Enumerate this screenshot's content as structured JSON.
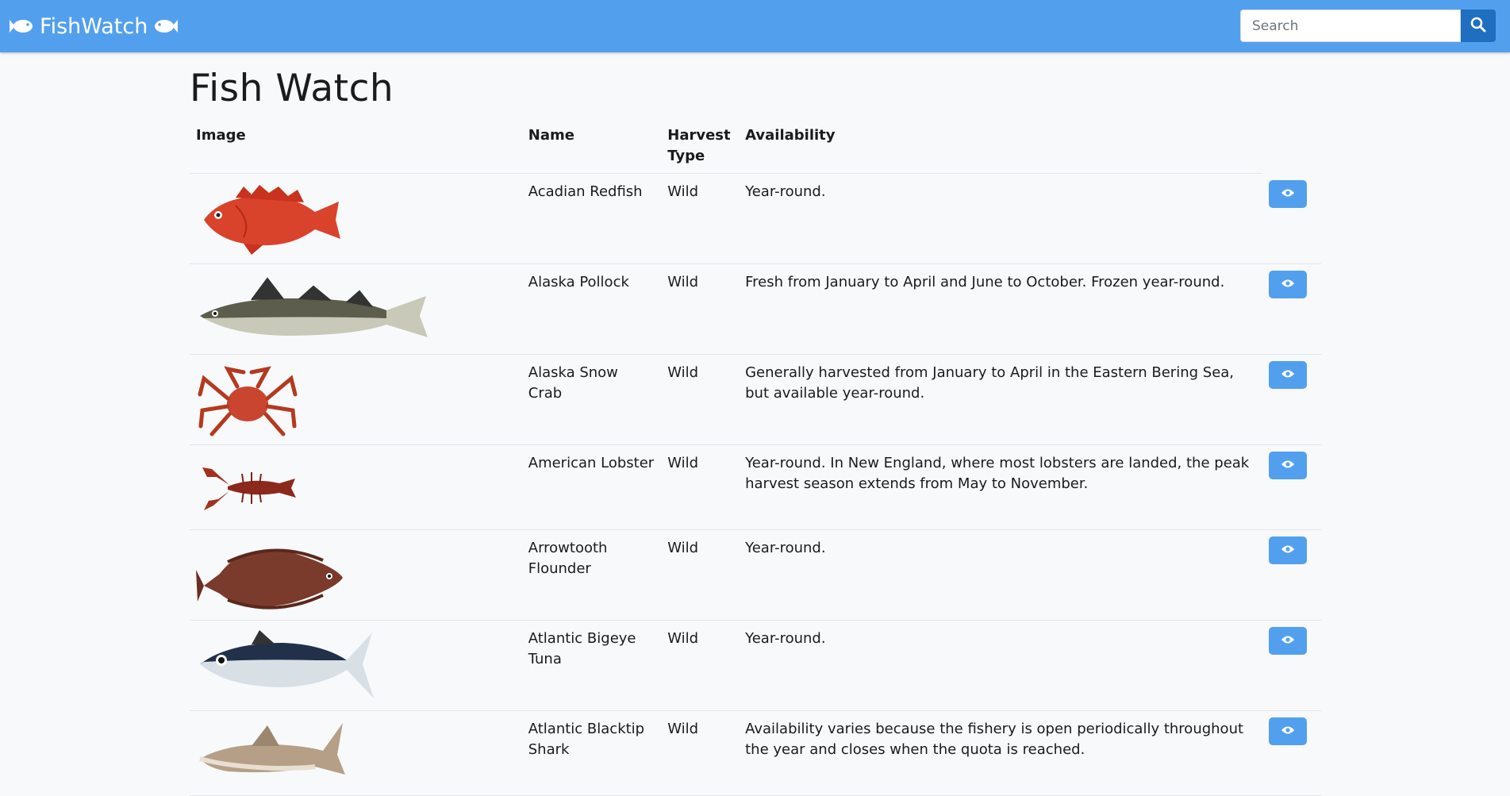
{
  "navbar": {
    "brand": "FishWatch",
    "search_placeholder": "Search",
    "colors": {
      "bar": "#52a0ed",
      "search_button": "#1f6ec0"
    }
  },
  "page_title": "Fish Watch",
  "table": {
    "headers": {
      "image": "Image",
      "name": "Name",
      "harvest_type": "Harvest Type",
      "availability": "Availability"
    },
    "rows": [
      {
        "name": "Acadian Redfish",
        "harvest_type": "Wild",
        "availability": "Year-round.",
        "image_icon": "redfish-image"
      },
      {
        "name": "Alaska Pollock",
        "harvest_type": "Wild",
        "availability": "Fresh from January to April and June to October. Frozen year-round.",
        "image_icon": "pollock-image"
      },
      {
        "name": "Alaska Snow Crab",
        "harvest_type": "Wild",
        "availability": "Generally harvested from January to April in the Eastern Bering Sea, but available year-round.",
        "image_icon": "crab-image"
      },
      {
        "name": "American Lobster",
        "harvest_type": "Wild",
        "availability": "Year-round. In New England, where most lobsters are landed, the peak harvest season extends from May to November.",
        "image_icon": "lobster-image"
      },
      {
        "name": "Arrowtooth Flounder",
        "harvest_type": "Wild",
        "availability": "Year-round.",
        "image_icon": "flounder-image"
      },
      {
        "name": "Atlantic Bigeye Tuna",
        "harvest_type": "Wild",
        "availability": "Year-round.",
        "image_icon": "tuna-image"
      },
      {
        "name": "Atlantic Blacktip Shark",
        "harvest_type": "Wild",
        "availability": "Availability varies because the fishery is open periodically throughout the year and closes when the quota is reached.",
        "image_icon": "shark-image"
      }
    ],
    "row_button_icon": "eye-icon",
    "accent": "#52a0ed"
  }
}
